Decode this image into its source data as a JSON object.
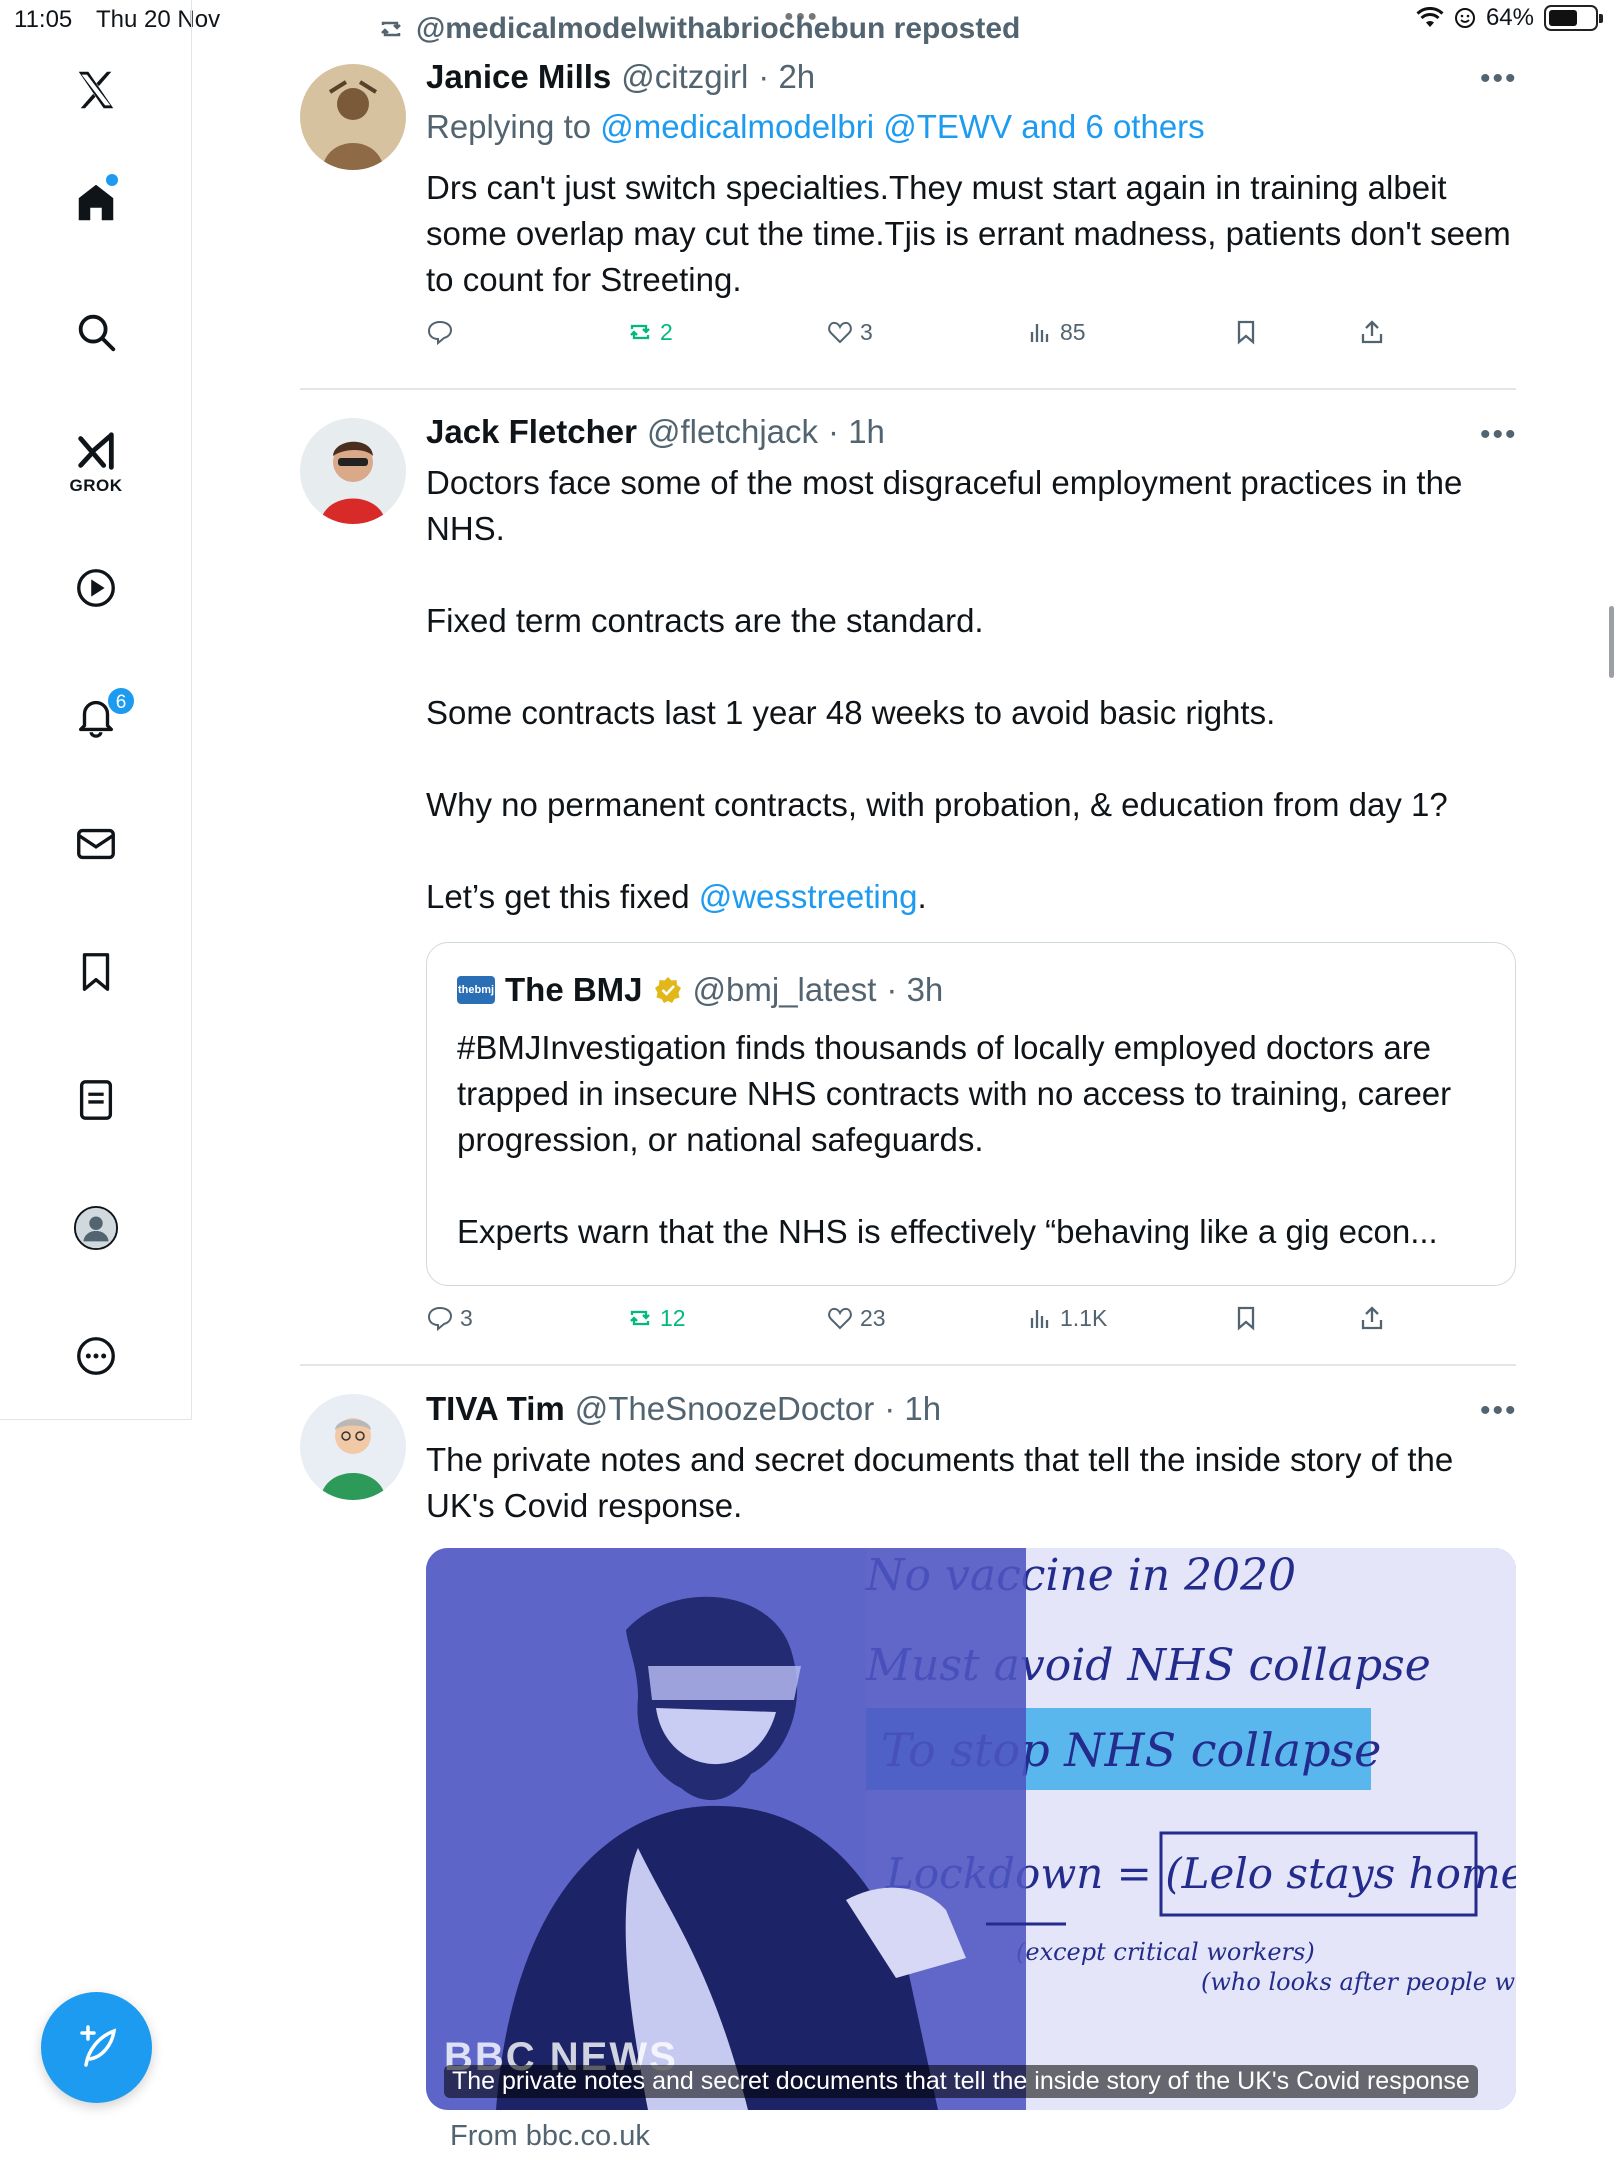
{
  "status_bar": {
    "time": "11:05",
    "date": "Thu 20 Nov",
    "battery": "64%",
    "battery_level": 0.64
  },
  "sidebar": {
    "grok_label": "GROK",
    "notifications_count": "6"
  },
  "feed": {
    "repost_line": "@medicalmodelwithabriochebun reposted",
    "tweets": [
      {
        "name": "Janice Mills",
        "handle": "@citzgirl",
        "time": "· 2h",
        "reply_prefix": "Replying to",
        "reply_to": "@medicalmodelbri @TEWV and 6 others",
        "text": "Drs can't just switch specialties.They must start again in training albeit some overlap may cut the time.Tjis is errant madness, patients don't seem to count for Streeting.",
        "replies": "",
        "reposts": "2",
        "likes": "3",
        "views": "85"
      },
      {
        "name": "Jack Fletcher",
        "handle": "@fletchjack",
        "time": "· 1h",
        "paragraphs": [
          "Doctors face some of the most disgraceful employment practices in the NHS.",
          "Fixed term contracts are the standard.",
          "Some contracts last 1 year 48 weeks to avoid basic rights.",
          "Why no permanent contracts, with probation, & education from day 1?"
        ],
        "last_line_prefix": "Let’s get this fixed ",
        "last_line_mention": "@wesstreeting",
        "last_line_suffix": ".",
        "quote": {
          "logo_text": "thebmj",
          "name": "The BMJ",
          "handle": "@bmj_latest",
          "time": "· 3h",
          "paragraph1": "#BMJInvestigation finds thousands of locally employed doctors are trapped in insecure NHS contracts with no access to training, career progression, or national safeguards.",
          "paragraph2": "Experts warn that the NHS is effectively “behaving like a gig econ..."
        },
        "replies": "3",
        "reposts": "12",
        "likes": "23",
        "views": "1.1K"
      },
      {
        "name": "TIVA Tim",
        "handle": "@TheSnoozeDoctor",
        "time": "· 1h",
        "text": "The private notes and secret documents that tell the inside story of the UK's Covid response.",
        "media": {
          "brand": "BBC NEWS",
          "caption": "The private notes and secret documents that tell the inside story of the UK's Covid response",
          "handwriting": [
            "No vaccine in 2020",
            "Must avoid NHS collapse",
            "To stop NHS collapse",
            "Lockdown = (Lelo stays home)",
            "(except critical workers)",
            "(who looks after people who can't survive?)"
          ]
        },
        "from_link": "From bbc.co.uk"
      }
    ]
  },
  "colors": {
    "accent": "#1d9bf0",
    "repost_green": "#00ba7c",
    "secondary_text": "#536471",
    "divider": "#e1e6ea"
  }
}
